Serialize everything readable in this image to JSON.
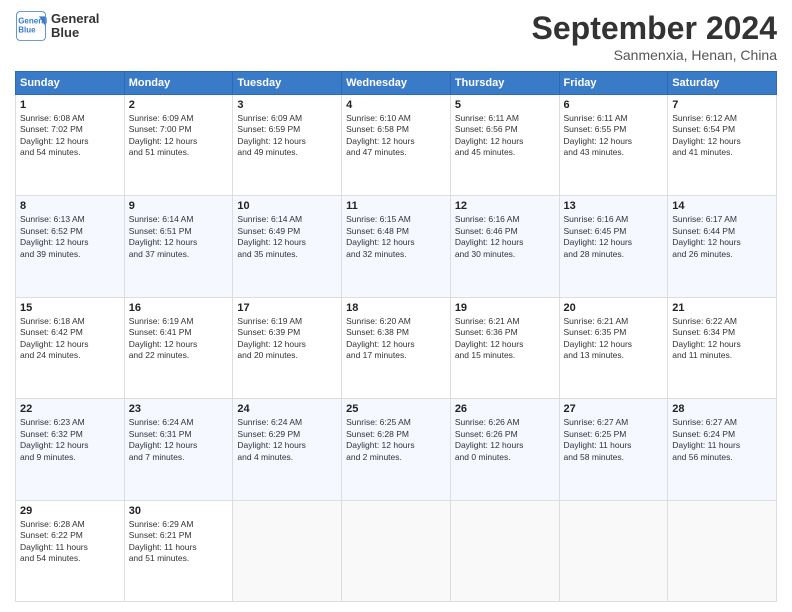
{
  "header": {
    "logo_line1": "General",
    "logo_line2": "Blue",
    "month": "September 2024",
    "location": "Sanmenxia, Henan, China"
  },
  "weekdays": [
    "Sunday",
    "Monday",
    "Tuesday",
    "Wednesday",
    "Thursday",
    "Friday",
    "Saturday"
  ],
  "weeks": [
    [
      {
        "day": "1",
        "sunrise": "6:08 AM",
        "sunset": "7:02 PM",
        "daylight": "12 hours and 54 minutes."
      },
      {
        "day": "2",
        "sunrise": "6:09 AM",
        "sunset": "7:00 PM",
        "daylight": "12 hours and 51 minutes."
      },
      {
        "day": "3",
        "sunrise": "6:09 AM",
        "sunset": "6:59 PM",
        "daylight": "12 hours and 49 minutes."
      },
      {
        "day": "4",
        "sunrise": "6:10 AM",
        "sunset": "6:58 PM",
        "daylight": "12 hours and 47 minutes."
      },
      {
        "day": "5",
        "sunrise": "6:11 AM",
        "sunset": "6:56 PM",
        "daylight": "12 hours and 45 minutes."
      },
      {
        "day": "6",
        "sunrise": "6:11 AM",
        "sunset": "6:55 PM",
        "daylight": "12 hours and 43 minutes."
      },
      {
        "day": "7",
        "sunrise": "6:12 AM",
        "sunset": "6:54 PM",
        "daylight": "12 hours and 41 minutes."
      }
    ],
    [
      {
        "day": "8",
        "sunrise": "6:13 AM",
        "sunset": "6:52 PM",
        "daylight": "12 hours and 39 minutes."
      },
      {
        "day": "9",
        "sunrise": "6:14 AM",
        "sunset": "6:51 PM",
        "daylight": "12 hours and 37 minutes."
      },
      {
        "day": "10",
        "sunrise": "6:14 AM",
        "sunset": "6:49 PM",
        "daylight": "12 hours and 35 minutes."
      },
      {
        "day": "11",
        "sunrise": "6:15 AM",
        "sunset": "6:48 PM",
        "daylight": "12 hours and 32 minutes."
      },
      {
        "day": "12",
        "sunrise": "6:16 AM",
        "sunset": "6:46 PM",
        "daylight": "12 hours and 30 minutes."
      },
      {
        "day": "13",
        "sunrise": "6:16 AM",
        "sunset": "6:45 PM",
        "daylight": "12 hours and 28 minutes."
      },
      {
        "day": "14",
        "sunrise": "6:17 AM",
        "sunset": "6:44 PM",
        "daylight": "12 hours and 26 minutes."
      }
    ],
    [
      {
        "day": "15",
        "sunrise": "6:18 AM",
        "sunset": "6:42 PM",
        "daylight": "12 hours and 24 minutes."
      },
      {
        "day": "16",
        "sunrise": "6:19 AM",
        "sunset": "6:41 PM",
        "daylight": "12 hours and 22 minutes."
      },
      {
        "day": "17",
        "sunrise": "6:19 AM",
        "sunset": "6:39 PM",
        "daylight": "12 hours and 20 minutes."
      },
      {
        "day": "18",
        "sunrise": "6:20 AM",
        "sunset": "6:38 PM",
        "daylight": "12 hours and 17 minutes."
      },
      {
        "day": "19",
        "sunrise": "6:21 AM",
        "sunset": "6:36 PM",
        "daylight": "12 hours and 15 minutes."
      },
      {
        "day": "20",
        "sunrise": "6:21 AM",
        "sunset": "6:35 PM",
        "daylight": "12 hours and 13 minutes."
      },
      {
        "day": "21",
        "sunrise": "6:22 AM",
        "sunset": "6:34 PM",
        "daylight": "12 hours and 11 minutes."
      }
    ],
    [
      {
        "day": "22",
        "sunrise": "6:23 AM",
        "sunset": "6:32 PM",
        "daylight": "12 hours and 9 minutes."
      },
      {
        "day": "23",
        "sunrise": "6:24 AM",
        "sunset": "6:31 PM",
        "daylight": "12 hours and 7 minutes."
      },
      {
        "day": "24",
        "sunrise": "6:24 AM",
        "sunset": "6:29 PM",
        "daylight": "12 hours and 4 minutes."
      },
      {
        "day": "25",
        "sunrise": "6:25 AM",
        "sunset": "6:28 PM",
        "daylight": "12 hours and 2 minutes."
      },
      {
        "day": "26",
        "sunrise": "6:26 AM",
        "sunset": "6:26 PM",
        "daylight": "12 hours and 0 minutes."
      },
      {
        "day": "27",
        "sunrise": "6:27 AM",
        "sunset": "6:25 PM",
        "daylight": "11 hours and 58 minutes."
      },
      {
        "day": "28",
        "sunrise": "6:27 AM",
        "sunset": "6:24 PM",
        "daylight": "11 hours and 56 minutes."
      }
    ],
    [
      {
        "day": "29",
        "sunrise": "6:28 AM",
        "sunset": "6:22 PM",
        "daylight": "11 hours and 54 minutes."
      },
      {
        "day": "30",
        "sunrise": "6:29 AM",
        "sunset": "6:21 PM",
        "daylight": "11 hours and 51 minutes."
      },
      null,
      null,
      null,
      null,
      null
    ]
  ]
}
